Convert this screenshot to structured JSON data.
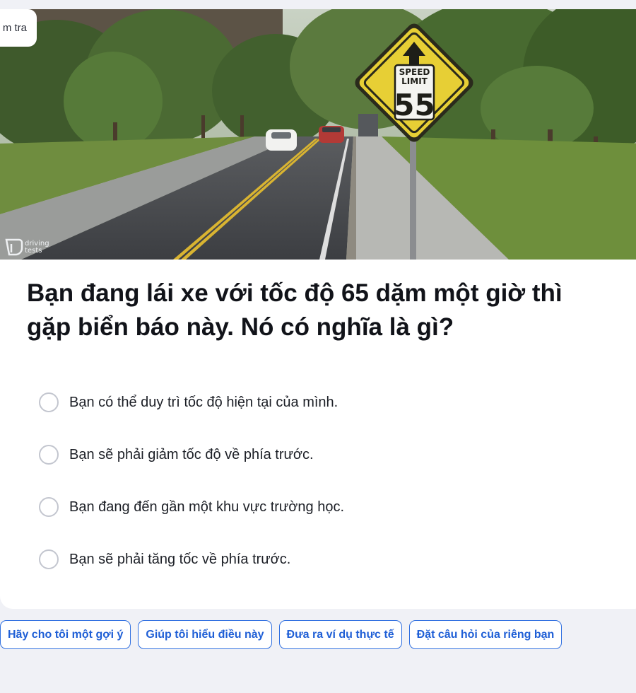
{
  "header": {
    "badge_text": "m tra"
  },
  "image": {
    "sign_line1": "SPEED",
    "sign_line2": "LIMIT",
    "sign_number": "55",
    "watermark_line1": "driving",
    "watermark_line2": "tests"
  },
  "question": {
    "text": "Bạn đang lái xe với tốc độ 65 dặm một giờ thì gặp biển báo này. Nó có nghĩa là gì?"
  },
  "options": [
    {
      "label": "Bạn có thể duy trì tốc độ hiện tại của mình."
    },
    {
      "label": "Bạn sẽ phải giảm tốc độ về phía trước."
    },
    {
      "label": "Bạn đang đến gần một khu vực trường học."
    },
    {
      "label": "Bạn sẽ phải tăng tốc về phía trước."
    }
  ],
  "suggestions": [
    {
      "label": "Hãy cho tôi một gợi ý"
    },
    {
      "label": "Giúp tôi hiểu điều này"
    },
    {
      "label": "Đưa ra ví dụ thực tế"
    },
    {
      "label": "Đặt câu hỏi của riêng bạn"
    }
  ]
}
